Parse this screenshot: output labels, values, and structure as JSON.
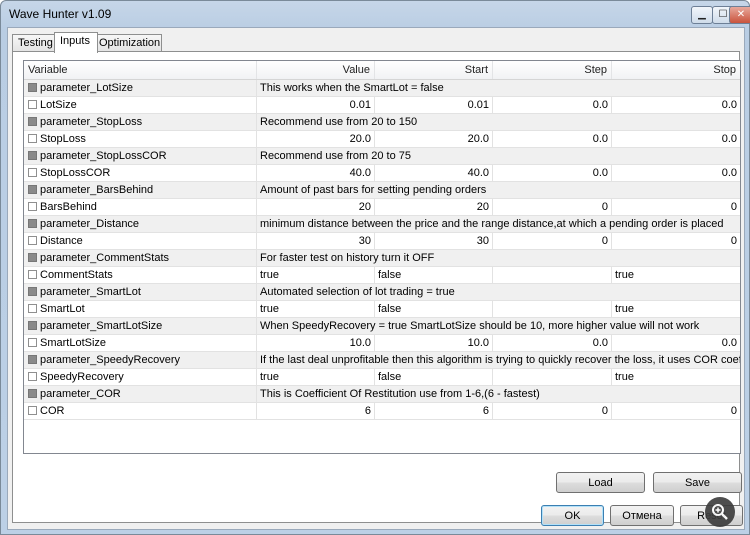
{
  "window": {
    "title": "Wave Hunter v1.09"
  },
  "tabs": [
    {
      "label": "Testing"
    },
    {
      "label": "Inputs"
    },
    {
      "label": "Optimization"
    }
  ],
  "grid": {
    "headers": {
      "variable": "Variable",
      "value": "Value",
      "start": "Start",
      "step": "Step",
      "stop": "Stop"
    },
    "rows": [
      {
        "kind": "param",
        "name": "parameter_LotSize",
        "desc": "This works when the SmartLot = false"
      },
      {
        "kind": "input",
        "name": "LotSize",
        "value": "0.01",
        "start": "0.01",
        "step": "0.0",
        "stop": "0.0"
      },
      {
        "kind": "param",
        "name": "parameter_StopLoss",
        "desc": "Recommend use from 20 to 150"
      },
      {
        "kind": "input",
        "name": "StopLoss",
        "value": "20.0",
        "start": "20.0",
        "step": "0.0",
        "stop": "0.0"
      },
      {
        "kind": "param",
        "name": "parameter_StopLossCOR",
        "desc": "Recommend use from 20 to 75"
      },
      {
        "kind": "input",
        "name": "StopLossCOR",
        "value": "40.0",
        "start": "40.0",
        "step": "0.0",
        "stop": "0.0"
      },
      {
        "kind": "param",
        "name": "parameter_BarsBehind",
        "desc": "Amount of past bars for setting pending orders"
      },
      {
        "kind": "input",
        "name": "BarsBehind",
        "value": "20",
        "start": "20",
        "step": "0",
        "stop": "0"
      },
      {
        "kind": "param",
        "name": "parameter_Distance",
        "desc": "minimum distance between the price and the range distance,at which a pending order is placed"
      },
      {
        "kind": "input",
        "name": "Distance",
        "value": "30",
        "start": "30",
        "step": "0",
        "stop": "0"
      },
      {
        "kind": "param",
        "name": "parameter_CommentStats",
        "desc": "For faster test on history turn it OFF"
      },
      {
        "kind": "bool",
        "name": "CommentStats",
        "value": "true",
        "start": "false",
        "step": "",
        "stop": "true"
      },
      {
        "kind": "param",
        "name": "parameter_SmartLot",
        "desc": "Automated selection of  lot trading = true"
      },
      {
        "kind": "bool",
        "name": "SmartLot",
        "value": "true",
        "start": "false",
        "step": "",
        "stop": "true"
      },
      {
        "kind": "param",
        "name": "parameter_SmartLotSize",
        "desc": "When SpeedyRecovery = true SmartLotSize should be 10, more higher value will not work"
      },
      {
        "kind": "input",
        "name": "SmartLotSize",
        "value": "10.0",
        "start": "10.0",
        "step": "0.0",
        "stop": "0.0"
      },
      {
        "kind": "param",
        "name": "parameter_SpeedyRecovery",
        "desc": "If the last deal unprofitable then this algorithm is trying to quickly recover the loss, it uses COR coefficient"
      },
      {
        "kind": "bool",
        "name": "SpeedyRecovery",
        "value": "true",
        "start": "false",
        "step": "",
        "stop": "true"
      },
      {
        "kind": "param",
        "name": "parameter_COR",
        "desc": "This is Coefficient Of Restitution use from 1-6,(6 - fastest)"
      },
      {
        "kind": "input",
        "name": "COR",
        "value": "6",
        "start": "6",
        "step": "0",
        "stop": "0"
      }
    ]
  },
  "buttons": {
    "load": "Load",
    "save": "Save",
    "ok": "OK",
    "cancel": "Отмена",
    "reset": "Reset"
  },
  "icons": {
    "minimize": "minimize-icon",
    "maximize": "maximize-icon",
    "close": "close-icon",
    "zoom": "magnifier-icon"
  }
}
